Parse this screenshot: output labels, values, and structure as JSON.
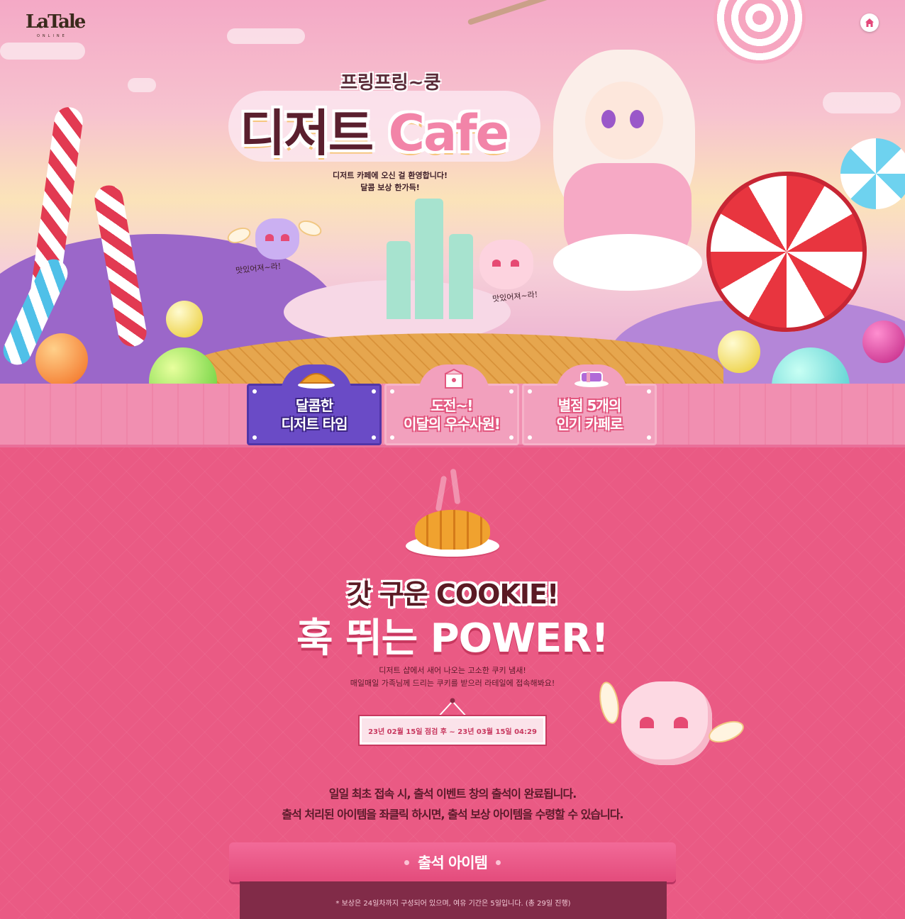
{
  "brand": {
    "logo_text": "LaTale",
    "logo_sub": "ONLINE"
  },
  "hero": {
    "title_sub": "프링프링~쿵",
    "title_main": "디저트",
    "title_cafe": "Cafe",
    "tagline_line1": "디저트 카페에 오신 걸  환영합니다!",
    "tagline_line2": "달콤 보상 한가득!",
    "speech_left": "맛있어져~라!",
    "speech_right": "맛있어져~라!"
  },
  "tabs": [
    {
      "line1": "달콤한",
      "line2": "디저트 타임",
      "active": true
    },
    {
      "line1": "도전~!",
      "line2": "이달의 우수사원!",
      "active": false
    },
    {
      "line1": "별점 5개의",
      "line2": "인기 카페로",
      "active": false
    }
  ],
  "main": {
    "headline1": "갓 구운 COOKIE!",
    "headline2": "훅 뛰는 POWER!",
    "desc_line1": "디저트 샵에서 새어 나오는 고소한 쿠키 냄새!",
    "desc_line2": "매일매일 가족님께 드리는 쿠키를 받으러 라테일에 접속해봐요!",
    "date_range": "23년 02월 15일 점검 후 ~ 23년 03월 15일 04:29",
    "notice_line1": "일일 최초 접속 시, 출석 이벤트 창의 출석이 완료됩니다.",
    "notice_line2": "출석 처리된 아이템을 좌클릭 하시면, 출석 보상 아이템을 수령할 수 있습니다.",
    "section_title": "출석 아이템",
    "section_note": "* 보상은 24일차까지 구성되어 있으며, 여유 기간은 5일입니다. (총 29일 진행)"
  },
  "icons": [
    "home-icon",
    "croissant-icon",
    "gift-box-icon",
    "candy-icon"
  ],
  "colors": {
    "background": "#ea5a84",
    "active_tab": "#6a4bc6",
    "inactive_tab": "#f2a0bd",
    "panel": "#812b48"
  }
}
